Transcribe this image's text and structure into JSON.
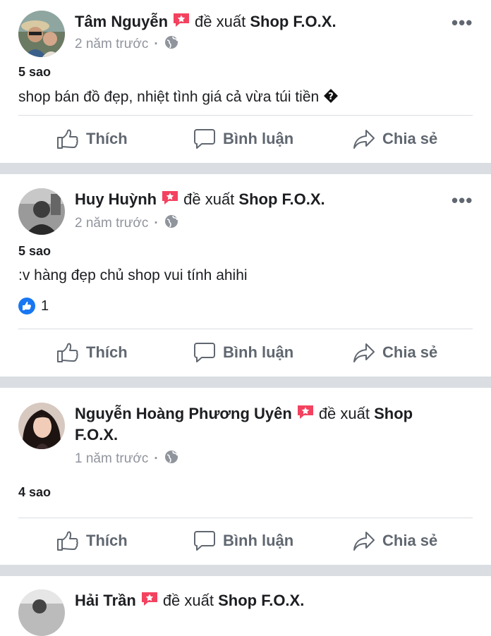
{
  "post_1": {
    "author": "Tâm Nguyễn",
    "verb": "đề xuất",
    "page": "Shop F.O.X.",
    "time": "2 năm trước",
    "rating": "5 sao",
    "text": "shop bán đồ đẹp, nhiệt tình giá cả vừa túi tiền"
  },
  "post_2": {
    "author": "Huy Huỳnh",
    "verb": "đề xuất",
    "page": "Shop F.O.X.",
    "time": "2 năm trước",
    "rating": "5 sao",
    "text": ":v hàng đẹp chủ shop vui tính ahihi",
    "like_count": "1"
  },
  "post_3": {
    "author": "Nguyễn Hoàng Phương Uyên",
    "verb": "đề xuất",
    "page_line1": "Shop",
    "page_line2": "F.O.X.",
    "time": "1 năm trước",
    "rating": "4 sao"
  },
  "post_4": {
    "author": "Hải Trần",
    "verb": "đề xuất",
    "page": "Shop F.O.X."
  },
  "actions": {
    "like": "Thích",
    "comment": "Bình luận",
    "share": "Chia sẻ"
  },
  "more_label": "•••",
  "colors": {
    "recommend": "#f3425f",
    "like_blue": "#1877f2",
    "separator": "#dadde1",
    "meta": "#90949c"
  },
  "icons": [
    "recommend-icon",
    "globe-icon",
    "more-options-icon",
    "like-icon",
    "comment-icon",
    "share-icon",
    "like-reaction-icon"
  ]
}
